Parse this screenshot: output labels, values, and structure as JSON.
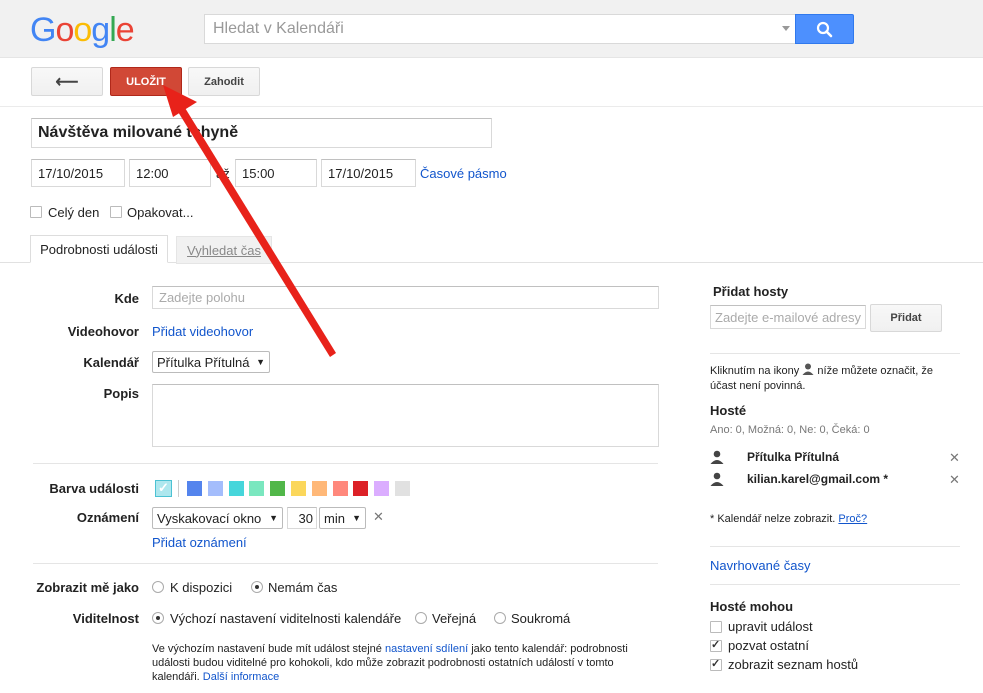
{
  "header": {
    "logo_letters": [
      {
        "ch": "G",
        "color": "#4285f4"
      },
      {
        "ch": "o",
        "color": "#ea4335"
      },
      {
        "ch": "o",
        "color": "#fbbc05"
      },
      {
        "ch": "g",
        "color": "#4285f4"
      },
      {
        "ch": "l",
        "color": "#34a853"
      },
      {
        "ch": "e",
        "color": "#ea4335"
      }
    ],
    "search_placeholder": "Hledat v Kalendáři"
  },
  "toolbar": {
    "back_label": "⟵",
    "save_label": "ULOŽIT",
    "discard_label": "Zahodit"
  },
  "event": {
    "title": "Návštěva milované tchyně",
    "start_date": "17/10/2015",
    "start_time": "12:00",
    "to_label": "až",
    "end_time": "15:00",
    "end_date": "17/10/2015",
    "timezone_link": "Časové pásmo",
    "allday_label": "Celý den",
    "repeat_label": "Opakovat..."
  },
  "tabs": {
    "details": "Podrobnosti události",
    "find_time": "Vyhledat čas"
  },
  "form": {
    "where_label": "Kde",
    "where_placeholder": "Zadejte polohu",
    "video_label": "Videohovor",
    "video_link": "Přidat videohovor",
    "calendar_label": "Kalendář",
    "calendar_value": "Přítulka Přítulná",
    "description_label": "Popis",
    "color_label": "Barva události",
    "colors": [
      "#5484ed",
      "#a4bdfc",
      "#46d6db",
      "#7ae7bf",
      "#51b749",
      "#fbd75b",
      "#ffb878",
      "#ff887c",
      "#dc2127",
      "#dbadff",
      "#e1e1e1"
    ],
    "notify_label": "Oznámení",
    "notify_type": "Vyskakovací okno",
    "notify_amount": "30",
    "notify_unit": "min",
    "add_notification": "Přidat oznámení",
    "show_as_label": "Zobrazit mě jako",
    "show_available": "K dispozici",
    "show_busy": "Nemám čas",
    "visibility_label": "Viditelnost",
    "vis_default": "Výchozí nastavení viditelnosti kalendáře",
    "vis_public": "Veřejná",
    "vis_private": "Soukromá",
    "vis_note_1": "Ve výchozím nastavení bude mít událost stejné",
    "vis_note_link": "nastavení sdílení",
    "vis_note_2": "jako tento kalendář: podrobnosti události budou viditelné pro kohokoli, kdo může zobrazit podrobnosti ostatních událostí v tomto kalendáři.",
    "vis_note_more": "Další informace"
  },
  "guests": {
    "title": "Přidat hosty",
    "input_placeholder": "Zadejte e-mailové adresy h",
    "add_button": "Přidat",
    "hint_1": "Kliknutím na ikony",
    "hint_2": "níže můžete označit, že účast není povinná.",
    "list_title": "Hosté",
    "counts": "Ano: 0, Možná: 0, Ne: 0, Čeká: 0",
    "items": [
      {
        "name": "Přítulka Přítulná"
      },
      {
        "name": "kilian.karel@gmail.com *"
      }
    ],
    "footnote": "* Kalendář nelze zobrazit.",
    "footnote_link": "Proč?",
    "suggested_times": "Navrhované časy",
    "can_title": "Hosté mohou",
    "perm_modify": "upravit událost",
    "perm_invite": "pozvat ostatní",
    "perm_seelist": "zobrazit seznam hostů"
  }
}
